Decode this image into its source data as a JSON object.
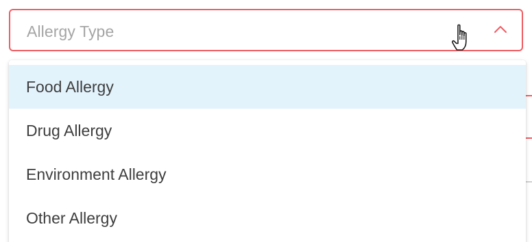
{
  "select": {
    "placeholder": "Allergy Type",
    "expanded": true,
    "border_color": "#ef5b61",
    "chevron_color": "#ef5b61"
  },
  "menu": {
    "highlight_color": "#e3f3fc",
    "items": [
      {
        "label": "Food Allergy",
        "highlighted": true
      },
      {
        "label": "Drug Allergy",
        "highlighted": false
      },
      {
        "label": "Environment Allergy",
        "highlighted": false
      },
      {
        "label": "Other Allergy",
        "highlighted": false
      }
    ]
  },
  "icons": {
    "chevron": "chevron-up-icon",
    "cursor": "hand-pointer-cursor-icon"
  }
}
